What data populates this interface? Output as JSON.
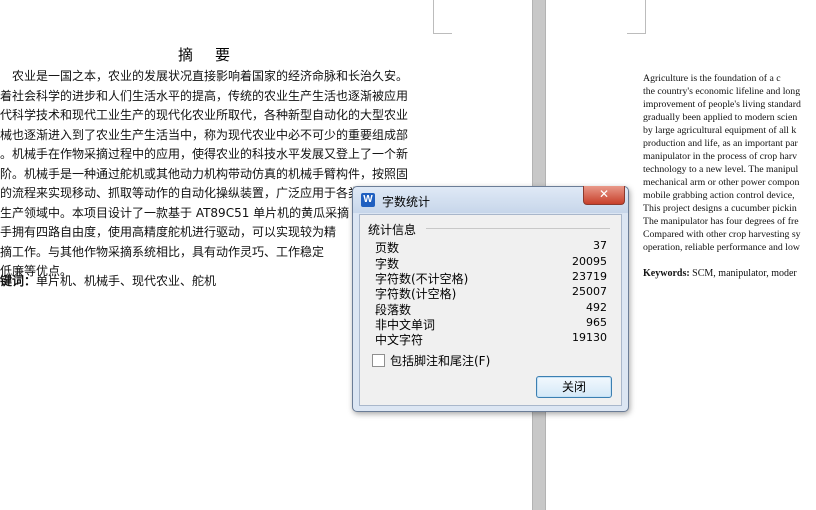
{
  "left_page": {
    "title_chars": [
      "摘",
      "要"
    ],
    "body_lines": [
      "　农业是一国之本，农业的发展状况直接影响着国家的经济命脉和长治久安。",
      "着社会科学的进步和人们生活水平的提高，传统的农业生产生活也逐渐被应用",
      "代科学技术和现代工业生产的现代化农业所取代，各种新型自动化的大型农业",
      "械也逐渐进入到了农业生产生活当中，称为现代农业中必不可少的重要组成部",
      "。机械手在作物采摘过程中的应用，使得农业的科技水平发展又登上了一个新",
      "阶。机械手是一种通过舵机或其他动力机构带动仿真的机械手臂构件，按照固",
      "的流程来实现移动、抓取等动作的自动化操纵装置，广泛应用于各类现代化工",
      "生产领域中。本项目设计了一款基于 AT89C51 单片机的黄瓜采摘",
      "手拥有四路自由度，使用高精度舵机进行驱动，可以实现较为精",
      "摘工作。与其他作物采摘系统相比，具有动作灵巧、工作稳定",
      "低廉等优点。"
    ],
    "keywords_label": "键词：",
    "keywords_text": "单片机、机械手、现代农业、舵机"
  },
  "right_page": {
    "body_lines": [
      "        Agriculture is the foundation of a c",
      "the country's economic lifeline and long",
      "improvement of people's living standard",
      "gradually been applied to modern scien",
      "by large agricultural equipment of all k",
      "production and life, as an important par",
      "manipulator in the process of crop harv",
      "technology to a new level. The manipul",
      "mechanical arm or other power compon",
      "mobile grabbing action control device, ",
      "This project designs a cucumber pickin",
      "The manipulator has four degrees of fre",
      "Compared with other crop harvesting sy",
      "operation, reliable performance and low"
    ],
    "keywords_label": "Keywords:",
    "keywords_text": "SCM, manipulator, moder"
  },
  "dialog": {
    "app_icon_letter": "W",
    "title": "字数统计",
    "close_glyph": "✕",
    "group_label": "统计信息",
    "stats": [
      {
        "label": "页数",
        "value": "37"
      },
      {
        "label": "字数",
        "value": "20095"
      },
      {
        "label": "字符数(不计空格)",
        "value": "23719"
      },
      {
        "label": "字符数(计空格)",
        "value": "25007"
      },
      {
        "label": "段落数",
        "value": "492"
      },
      {
        "label": "非中文单词",
        "value": "965"
      },
      {
        "label": "中文字符",
        "value": "19130"
      }
    ],
    "checkbox_label": "包括脚注和尾注(F)",
    "checkbox_checked": false,
    "close_button_label": "关闭"
  },
  "colors": {
    "dialog_frame": "#dce6f3",
    "close_red": "#c7402b",
    "gutter": "#c8c8c8"
  }
}
